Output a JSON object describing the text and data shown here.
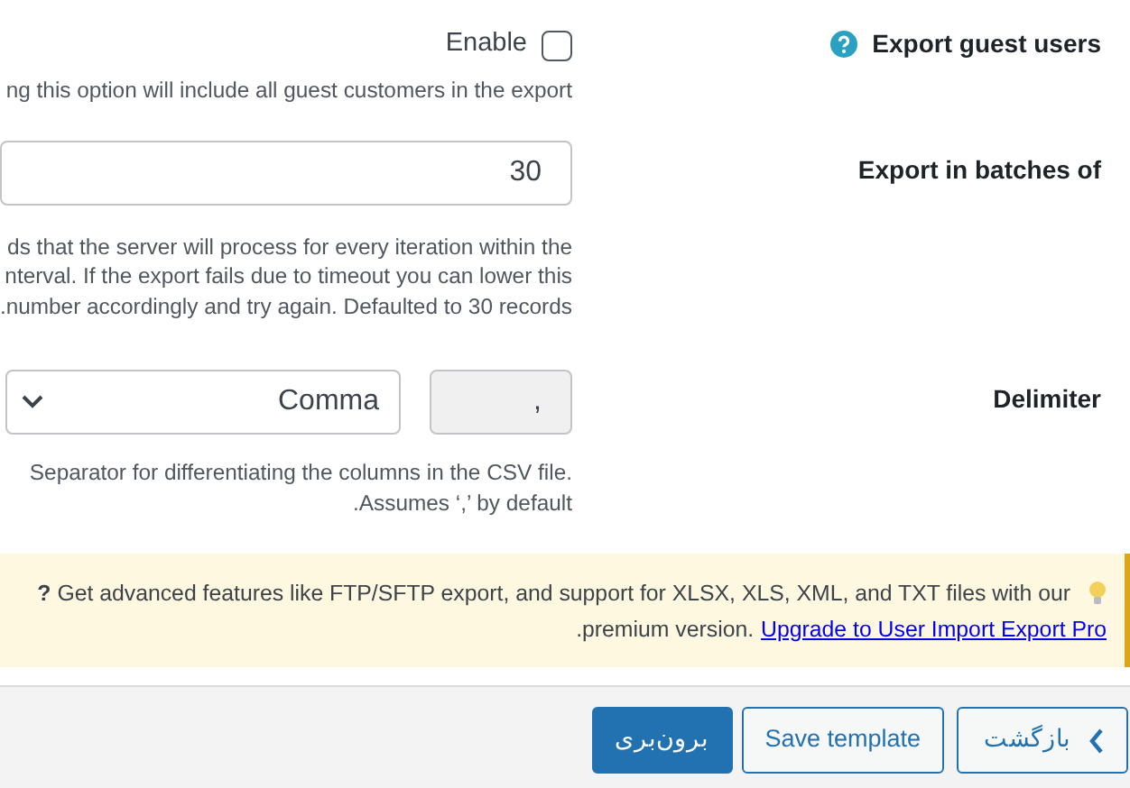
{
  "options": [
    {
      "kind": "checkbox",
      "label": "Export guest users",
      "help": true,
      "option_label": "Enable",
      "checked": false,
      "description": [
        "ng this option will include all guest customers in the export"
      ]
    },
    {
      "kind": "number",
      "label": "Export in batches of",
      "value": "30",
      "description": [
        "ds that the server will process for every iteration within the",
        "nterval. If the export fails due to timeout you can lower this",
        ".number accordingly and try again. Defaulted to 30 records"
      ]
    },
    {
      "kind": "delimiter",
      "label": "Delimiter",
      "select_value": "Comma",
      "delimiter_value": ",",
      "description": [
        "Separator for differentiating the columns in the CSV file.",
        ".Assumes ‘,’ by default"
      ]
    }
  ],
  "notice": {
    "lines": [
      "**?** Get advanced features like FTP/SFTP export, and support for XLSX, XLS, XML, and TXT files with our",
      ".premium version."
    ],
    "link": "Upgrade to User Import Export Pro"
  },
  "footer": {
    "buttons": [
      {
        "label": "بازگشت",
        "kind": "back"
      },
      {
        "label": "Save template",
        "kind": "secondary"
      },
      {
        "label": "برون‌بری",
        "kind": "primary"
      }
    ]
  }
}
